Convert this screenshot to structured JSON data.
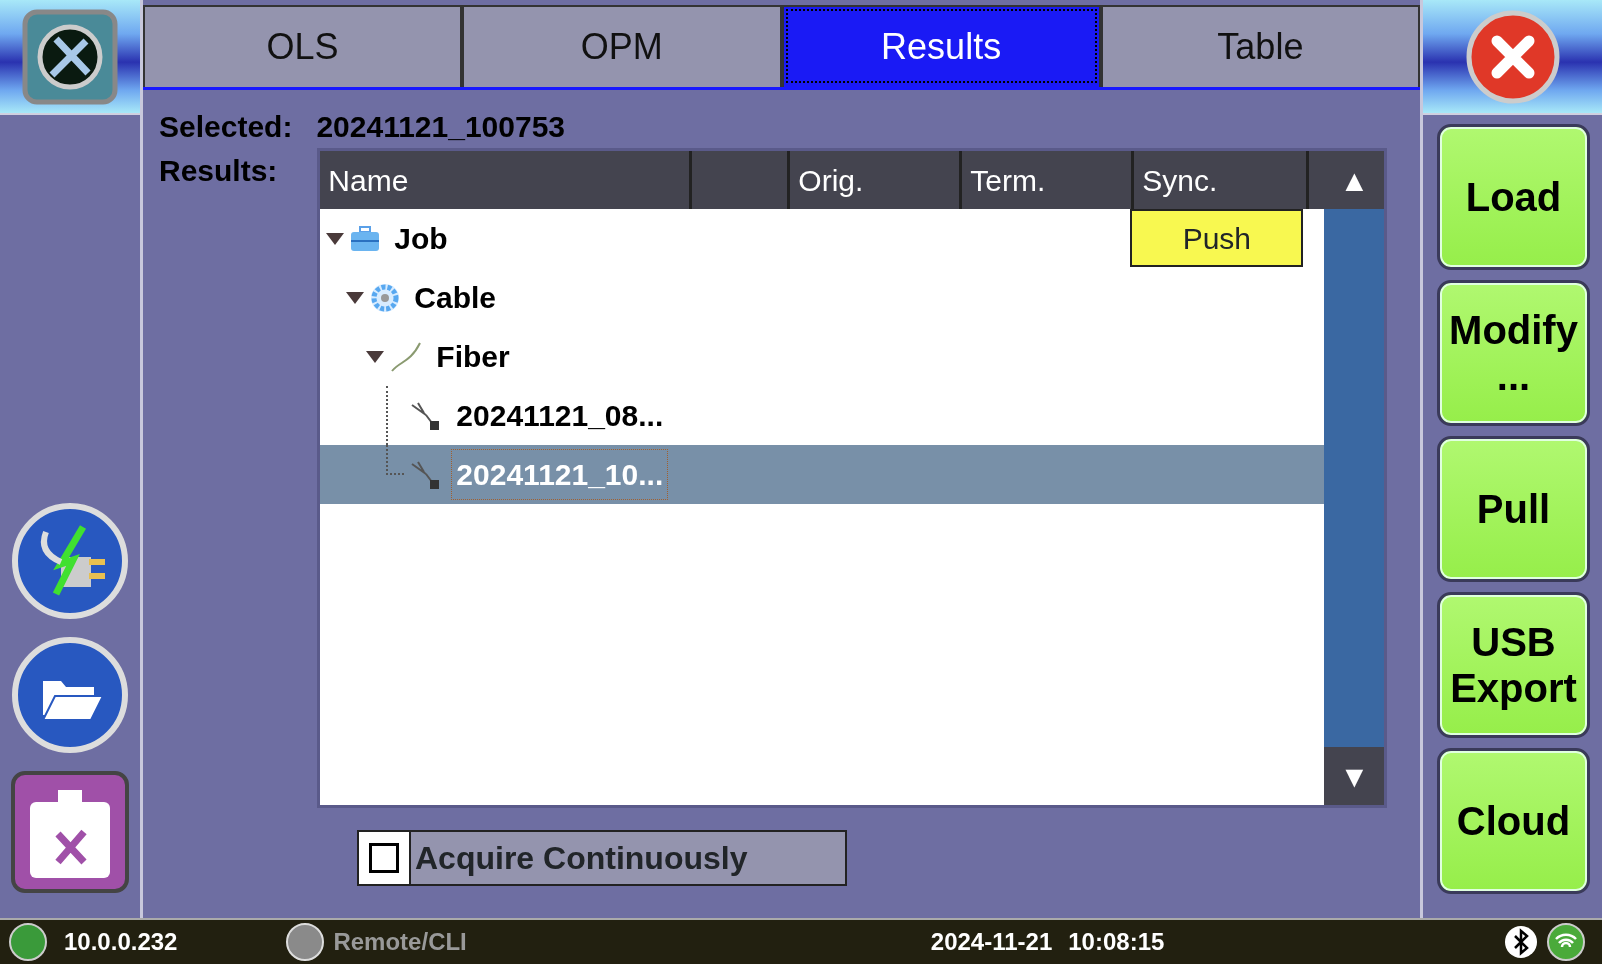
{
  "tabs": [
    {
      "label": "OLS",
      "selected": false
    },
    {
      "label": "OPM",
      "selected": false
    },
    {
      "label": "Results",
      "selected": true
    },
    {
      "label": "Table",
      "selected": false
    }
  ],
  "selected": {
    "label": "Selected:",
    "value": "20241121_100753"
  },
  "results": {
    "label": "Results:",
    "columns": [
      {
        "label": "Name"
      },
      {},
      {
        "label": "Orig."
      },
      {
        "label": "Term."
      },
      {
        "label": "Sync."
      }
    ],
    "scroll_up": "▲",
    "scroll_down": "▼",
    "tree": [
      {
        "label": "Job",
        "kind": "job",
        "expanded": true,
        "selected": false,
        "sync": "Push",
        "children": [
          {
            "label": "Cable",
            "kind": "cable",
            "expanded": true,
            "selected": false,
            "children": [
              {
                "label": "Fiber",
                "kind": "fiber",
                "expanded": true,
                "selected": false,
                "children": [
                  {
                    "label": "20241121_08...",
                    "kind": "result",
                    "selected": false
                  },
                  {
                    "label": "20241121_10...",
                    "kind": "result",
                    "selected": true
                  }
                ]
              }
            ]
          }
        ]
      }
    ]
  },
  "acquire": {
    "label": "Acquire Continuously",
    "checked": false
  },
  "actions": [
    "Load",
    "Modify\n...",
    "Pull",
    "USB\nExport",
    "Cloud"
  ],
  "status_bar": {
    "ip": "10.0.0.232",
    "remote": {
      "label": "Remote/CLI",
      "disabled": true
    },
    "date": "2024-11-21",
    "time": "10:08:15"
  }
}
